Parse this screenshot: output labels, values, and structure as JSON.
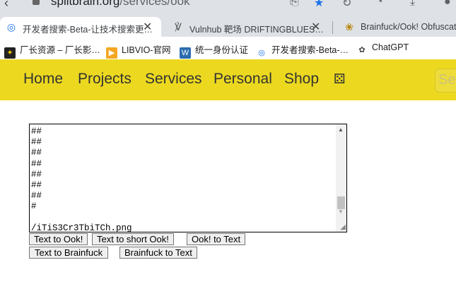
{
  "browser": {
    "url_host": "splitbrain.org",
    "url_path": "/services/ook",
    "tabs": [
      {
        "title": "开发者搜索-Beta-让技术搜索更…",
        "active": true
      },
      {
        "title": "Vulnhub 靶场 DRIFTINGBLUES…",
        "active": false
      },
      {
        "title": "Brainfuck/Ook! Obfuscati",
        "active": false
      }
    ],
    "bookmarks": [
      {
        "label": "厂长资源 – 厂长影…"
      },
      {
        "label": "LIBVIO-官网"
      },
      {
        "label": "统一身份认证"
      },
      {
        "label": "开发者搜索-Beta-…"
      },
      {
        "label": "ChatGPT"
      }
    ]
  },
  "nav": {
    "items": [
      "Home",
      "Projects",
      "Services",
      "Personal",
      "Shop"
    ],
    "dice_icon": "⚄",
    "search_placeholder": "Se"
  },
  "editor": {
    "content": "##\n##\n##\n##\n##\n##\n##\n#\n\n/iTiS3Cr3TbiTCh.png"
  },
  "buttons": {
    "text_to_ook": "Text to Ook!",
    "text_to_short_ook": "Text to short Ook!",
    "ook_to_text": "Ook! to Text",
    "text_to_brainfuck": "Text to Brainfuck",
    "brainfuck_to_text": "Brainfuck to Text"
  }
}
